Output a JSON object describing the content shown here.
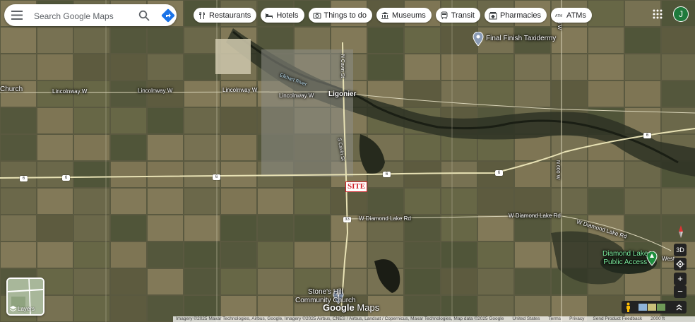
{
  "search": {
    "placeholder": "Search Google Maps"
  },
  "chips": [
    {
      "label": "Restaurants",
      "icon": "fork-knife-icon"
    },
    {
      "label": "Hotels",
      "icon": "bed-icon"
    },
    {
      "label": "Things to do",
      "icon": "camera-icon"
    },
    {
      "label": "Museums",
      "icon": "museum-icon"
    },
    {
      "label": "Transit",
      "icon": "train-icon"
    },
    {
      "label": "Pharmacies",
      "icon": "pharmacy-icon"
    },
    {
      "label": "ATMs",
      "icon": "atm-icon"
    }
  ],
  "account": {
    "initial": "J",
    "color": "#1e7a3c"
  },
  "map_labels": {
    "church_left": "Church",
    "lincolnway_w1": "Lincolnway W",
    "lincolnway_w2": "Lincolnway W",
    "lincolnway_w3": "Lincolnway W",
    "lincolnway_w4": "Lincolnway W",
    "ligonier": "Ligonier",
    "elkhart_river": "Elkhart River",
    "cavin_st": "N Cavin St",
    "cavin_st_s": "S Cavin St",
    "w_diamond_lake_rd": "W Diamond Lake Rd",
    "w_diamond_lake_rd2": "W Diamond Lake Rd",
    "w_diamond_lake_rd3": "W Diamond Lake Rd",
    "n600w_top": "N 600 W",
    "n600w_mid": "N 600 W",
    "west_label": "West"
  },
  "road_shields": {
    "r6a": "6",
    "r6b": "6",
    "r6c": "6",
    "r6d": "6",
    "r6e": "6",
    "r33": "33"
  },
  "pois": {
    "taxidermy": "Final Finish Taxidermy",
    "diamond_lake": "Diamond Lake\nPublic Access",
    "stones_hill": "Stone's Hill\nCommunity Church"
  },
  "site_label": "SITE",
  "layers_label": "Layers",
  "controls": {
    "three_d": "3D",
    "zoom_in": "+",
    "zoom_out": "−"
  },
  "branding": {
    "google": "Google",
    "maps": "Maps"
  },
  "footer": {
    "imagery": "Imagery ©2025 Maxar Technologies, Airbus, Google, Imagery ©2025 Airbus, CNES / Airbus, Landsat / Copernicus, Maxar Technologies, Map data ©2025 Google",
    "country": "United States",
    "terms": "Terms",
    "privacy": "Privacy",
    "feedback": "Send Product Feedback",
    "scale": "2000 ft"
  }
}
